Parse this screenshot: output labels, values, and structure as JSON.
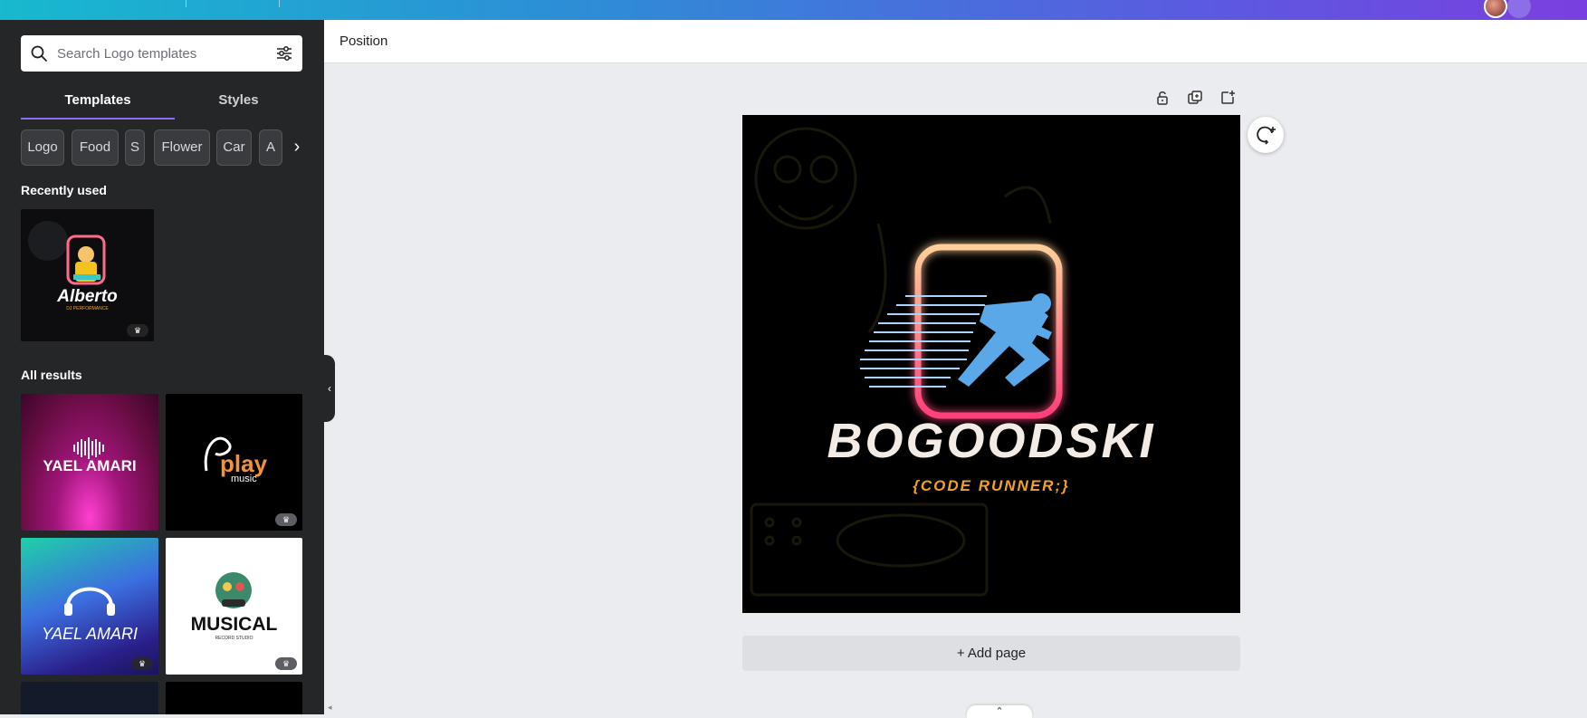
{
  "search": {
    "placeholder": "Search Logo templates"
  },
  "tabs": [
    {
      "label": "Templates",
      "active": true
    },
    {
      "label": "Styles",
      "active": false
    }
  ],
  "chips": [
    "Logo",
    "Food",
    "S",
    "Flower",
    "Car",
    "A"
  ],
  "recently_used": {
    "title": "Recently used",
    "items": [
      {
        "name": "Alberto",
        "subtitle": "DJ PERFORMANCE",
        "premium": true
      }
    ]
  },
  "all_results": {
    "title": "All results",
    "items": [
      {
        "name": "YAEL AMARI",
        "premium": false
      },
      {
        "name": "play",
        "sub": "music",
        "premium": true
      },
      {
        "name": "YAEL AMARI",
        "premium": true
      },
      {
        "name": "MUSICAL",
        "sub": "RECORD STUDIO",
        "premium": true
      }
    ]
  },
  "toolbar": {
    "position_label": "Position"
  },
  "canvas": {
    "brand": "BOGOODSKI",
    "tagline": "{CODE RUNNER;}",
    "background": "#000000",
    "accent_orange": "#f0a12a",
    "runner_color": "#5aa8e8"
  },
  "add_page_label": "+ Add page",
  "colors": {
    "sidebar": "#252627",
    "tab_underline": "#8b6ff0",
    "workspace": "#ebecf0"
  }
}
